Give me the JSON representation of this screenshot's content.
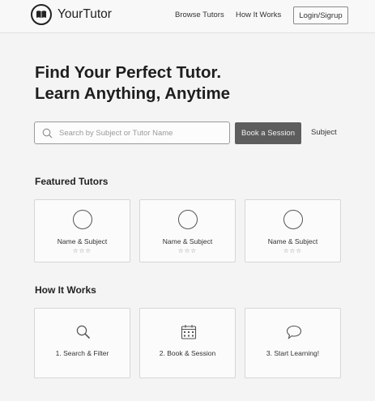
{
  "header": {
    "logo_text": "YourTutor",
    "nav": [
      {
        "label": "Browse Tutors"
      },
      {
        "label": "How It Works"
      }
    ],
    "login_label": "Login/Sigrup"
  },
  "hero": {
    "line1": "Find Your Perfect Tutor.",
    "line2": "Learn Anything, Anytime"
  },
  "search": {
    "placeholder": "Search by Subject or Tutor Name",
    "value": "",
    "button_label": "Book a Session",
    "filter_label": "Subject"
  },
  "featured": {
    "title": "Featured Tutors",
    "tutors": [
      {
        "label": "Name & Subject",
        "stars": "☆☆☆"
      },
      {
        "label": "Name & Subject",
        "stars": "☆☆☆"
      },
      {
        "label": "Name & Subject",
        "stars": "☆☆☆"
      }
    ]
  },
  "how_it_works": {
    "title": "How It Works",
    "steps": [
      {
        "label": "1. Search & Filter",
        "icon": "magnifier-icon"
      },
      {
        "label": "2. Book & Session",
        "icon": "calendar-icon"
      },
      {
        "label": "3. Start Learning!",
        "icon": "chat-bubble-icon"
      }
    ]
  }
}
